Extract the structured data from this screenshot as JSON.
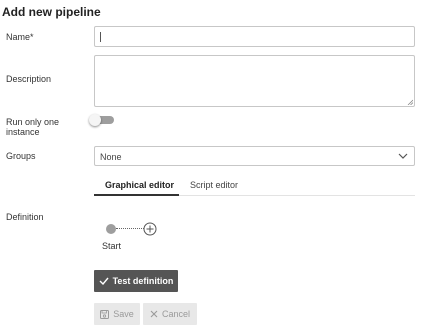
{
  "page": {
    "title": "Add new pipeline"
  },
  "form": {
    "name_label": "Name*",
    "name_value": "",
    "description_label": "Description",
    "description_value": "",
    "run_once_label_line1": "Run only one",
    "run_once_label_line2": "instance",
    "run_once_enabled": false,
    "groups_label": "Groups",
    "groups_selected": "None",
    "definition_label": "Definition"
  },
  "tabs": [
    {
      "label": "Graphical editor",
      "active": true
    },
    {
      "label": "Script editor",
      "active": false
    }
  ],
  "editor": {
    "start_label": "Start"
  },
  "buttons": {
    "test": "Test definition",
    "save": "Save",
    "cancel": "Cancel"
  },
  "colors": {
    "primary_button": "#555555",
    "disabled_button": "#e8e8e8",
    "disabled_text": "#9a9a9a",
    "toggle_track": "#9e9e9e"
  },
  "icons": {
    "test": "check-icon",
    "save": "save-icon",
    "cancel": "close-icon",
    "groups": "chevron-down-icon",
    "add_step": "plus-circle-icon"
  }
}
